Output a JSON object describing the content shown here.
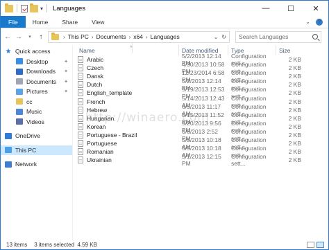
{
  "window": {
    "title": "Languages"
  },
  "ribbon": {
    "tabs": [
      "File",
      "Home",
      "Share",
      "View"
    ]
  },
  "address": {
    "crumbs": [
      "This PC",
      "Documents",
      "x64",
      "Languages"
    ],
    "search_placeholder": "Search Languages"
  },
  "nav": {
    "items": [
      {
        "label": "Quick access",
        "icon": "star-icon",
        "level": 1,
        "pinned": false
      },
      {
        "label": "Desktop",
        "icon": "desktop-icon",
        "level": 2,
        "pinned": true
      },
      {
        "label": "Downloads",
        "icon": "downloads-icon",
        "level": 2,
        "pinned": true
      },
      {
        "label": "Documents",
        "icon": "documents-icon",
        "level": 2,
        "pinned": true
      },
      {
        "label": "Pictures",
        "icon": "pictures-icon",
        "level": 2,
        "pinned": true
      },
      {
        "label": "cc",
        "icon": "folder-icon",
        "level": 2,
        "pinned": false
      },
      {
        "label": "Music",
        "icon": "music-icon",
        "level": 2,
        "pinned": false
      },
      {
        "label": "Videos",
        "icon": "videos-icon",
        "level": 2,
        "pinned": false
      },
      {
        "label": "OneDrive",
        "icon": "onedrive-icon",
        "level": 1,
        "pinned": false
      },
      {
        "label": "This PC",
        "icon": "pc-icon",
        "level": 1,
        "pinned": false,
        "selected": true
      },
      {
        "label": "Network",
        "icon": "network-icon",
        "level": 1,
        "pinned": false
      }
    ]
  },
  "columns": {
    "name": "Name",
    "date": "Date modified",
    "type": "Type",
    "size": "Size"
  },
  "files": [
    {
      "name": "Arabic",
      "date": "5/2/2013 12:14 PM",
      "type": "Configuration sett...",
      "size": "2 KB"
    },
    {
      "name": "Czech",
      "date": "4/30/2013 10:58 PM",
      "type": "Configuration sett...",
      "size": "2 KB"
    },
    {
      "name": "Dansk",
      "date": "12/23/2014 6:58 PM",
      "type": "Configuration sett...",
      "size": "2 KB"
    },
    {
      "name": "Dutch",
      "date": "5/2/2013 12:14 PM",
      "type": "Configuration sett...",
      "size": "2 KB"
    },
    {
      "name": "English_template",
      "date": "9/19/2013 12:53 PM",
      "type": "Configuration sett...",
      "size": "2 KB"
    },
    {
      "name": "French",
      "date": "5/14/2013 12:43 AM",
      "type": "Configuration sett...",
      "size": "2 KB"
    },
    {
      "name": "Hebrew",
      "date": "6/5/2013 11:17 AM",
      "type": "Configuration sett...",
      "size": "2 KB"
    },
    {
      "name": "Hungarian",
      "date": "5/15/2013 11:52 PM",
      "type": "Configuration sett...",
      "size": "2 KB"
    },
    {
      "name": "Korean",
      "date": "9/20/2013 9:56 PM",
      "type": "Configuration sett...",
      "size": "2 KB"
    },
    {
      "name": "Portuguese - Brazil",
      "date": "6/6/2013 2:52 PM",
      "type": "Configuration sett...",
      "size": "2 KB"
    },
    {
      "name": "Portuguese",
      "date": "5/5/2013 10:18 AM",
      "type": "Configuration sett...",
      "size": "2 KB"
    },
    {
      "name": "Romanian",
      "date": "5/5/2013 10:18 AM",
      "type": "Configuration sett...",
      "size": "2 KB"
    },
    {
      "name": "Ukrainian",
      "date": "5/1/2013 12:15 PM",
      "type": "Configuration sett...",
      "size": "2 KB"
    }
  ],
  "watermark": "http://winaero.com",
  "status": {
    "count": "13 items",
    "selection": "3 items selected  4.59 KB"
  },
  "colors": {
    "accent": "#1979ca",
    "selection": "#cce8ff"
  }
}
